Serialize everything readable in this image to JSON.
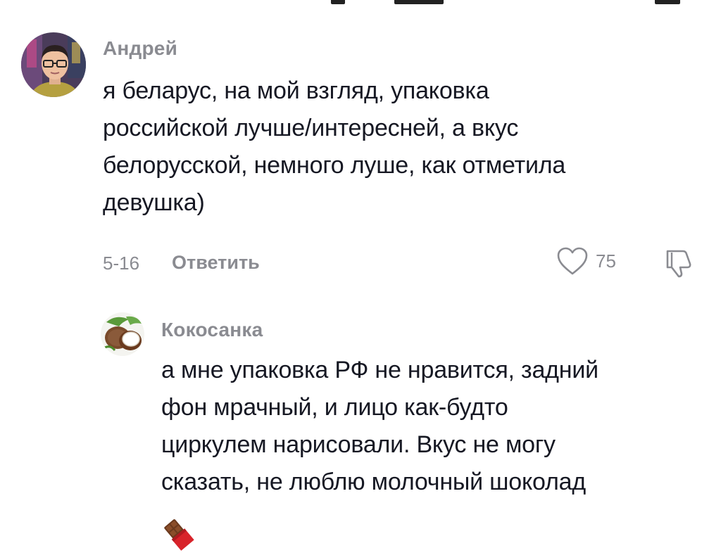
{
  "comments": [
    {
      "author": "Андрей",
      "text_lines": [
        "я беларус, на мой взгляд, упаковка",
        "российской лучше/интересней, а вкус",
        "белорусской, немного луше, как отметила",
        "девушка)"
      ],
      "date": "5-16",
      "reply_label": "Ответить",
      "like_count": "75",
      "avatar_icon": "man-with-glasses-avatar"
    },
    {
      "author": "Кокосанка",
      "text_lines": [
        "а мне упаковка РФ не нравится, задний",
        "фон мрачный, и лицо как-будто",
        "циркулем нарисовали. Вкус не могу",
        "сказать, не люблю молочный шоколад"
      ],
      "emoji_icon": "chocolate-bar-emoji",
      "avatar_icon": "coconut-avatar"
    }
  ],
  "icons": {
    "like": "heart-outline-icon",
    "dislike": "thumbs-down-outline-icon"
  },
  "colors": {
    "text": "#161823",
    "secondary": "#8a8b91"
  }
}
